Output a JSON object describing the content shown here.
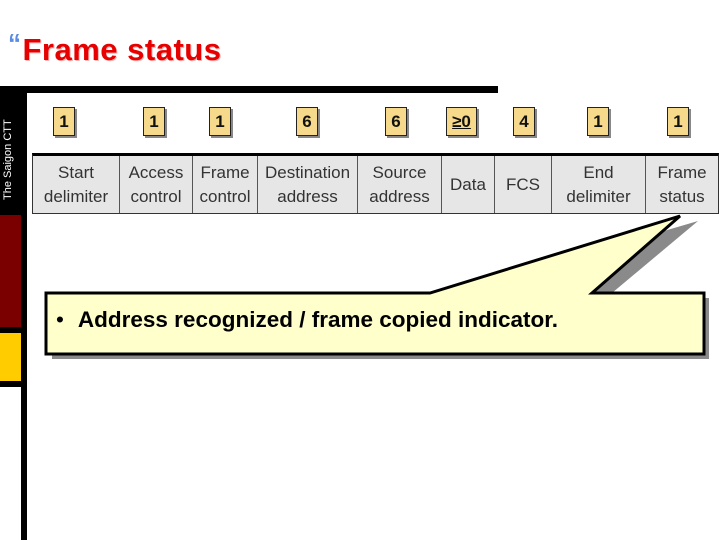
{
  "slide": {
    "title": "Frame status",
    "title_bullet": "“",
    "side_label": "The Saigon CTT",
    "colors": {
      "title": "#e60000",
      "side_red": "#7a0000",
      "side_yellow": "#ffcc00",
      "badge": "#f6d98a",
      "field_bg": "#e6e6e6",
      "callout_bg": "#ffffcc"
    }
  },
  "frame": {
    "fields": [
      {
        "label": "Start\ndelimiter",
        "bytes": "1"
      },
      {
        "label": "Access\ncontrol",
        "bytes": "1"
      },
      {
        "label": "Frame\ncontrol",
        "bytes": "1"
      },
      {
        "label": "Destination\naddress",
        "bytes": "6"
      },
      {
        "label": "Source\naddress",
        "bytes": "6"
      },
      {
        "label": "Data",
        "bytes": "≥0"
      },
      {
        "label": "FCS",
        "bytes": "4"
      },
      {
        "label": "End\ndelimiter",
        "bytes": "1"
      },
      {
        "label": "Frame\nstatus",
        "bytes": "1"
      }
    ]
  },
  "callout": {
    "bullet": "•",
    "text": "Address recognized / frame copied indicator.",
    "points_to": "Frame status"
  }
}
